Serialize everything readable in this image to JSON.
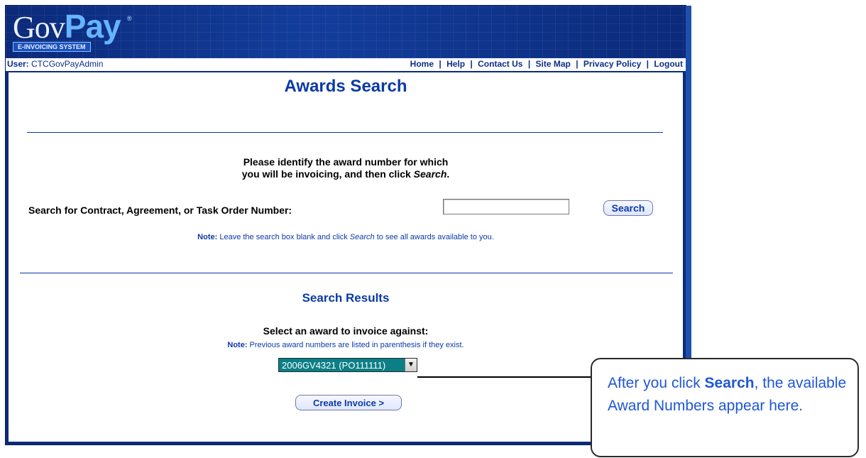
{
  "header": {
    "logo_gov": "Gov",
    "logo_pay": "Pay",
    "logo_tm": "®",
    "logo_tagline": "E-INVOICING SYSTEM",
    "user_prefix": "User:",
    "user_name": "CTCGovPayAdmin",
    "nav": [
      "Home",
      "Help",
      "Contact Us",
      "Site Map",
      "Privacy Policy",
      "Logout"
    ],
    "nav_sep": "|"
  },
  "page": {
    "title": "Awards Search",
    "instructions_line1": "Please identify the award number for which",
    "instructions_line2_pre": "you will be invoicing, and then click ",
    "instructions_line2_em": "Search",
    "instructions_line2_post": ".",
    "search_label": "Search for Contract, Agreement, or Task Order Number:",
    "search_value": "",
    "search_button": "Search",
    "note1_prefix": "Note:",
    "note1_pre": " Leave the search box blank and click ",
    "note1_em": "Search",
    "note1_post": " to see all awards available to you."
  },
  "results": {
    "title": "Search Results",
    "select_label": "Select an award to invoice against:",
    "note2_prefix": "Note:",
    "note2_text": " Previous award numbers are listed in parenthesis if they exist.",
    "selected_award": "2006GV4321 (PO111111)",
    "create_invoice_button": "Create Invoice >"
  },
  "callout": {
    "pre": "After you click ",
    "bold": "Search",
    "post": ", the available Award Numbers appear here."
  },
  "colors": {
    "brand_blue": "#0b3aa6",
    "header_dark": "#0b2a7a",
    "callout_text": "#1f56d6",
    "select_bg": "#0b7f86"
  }
}
